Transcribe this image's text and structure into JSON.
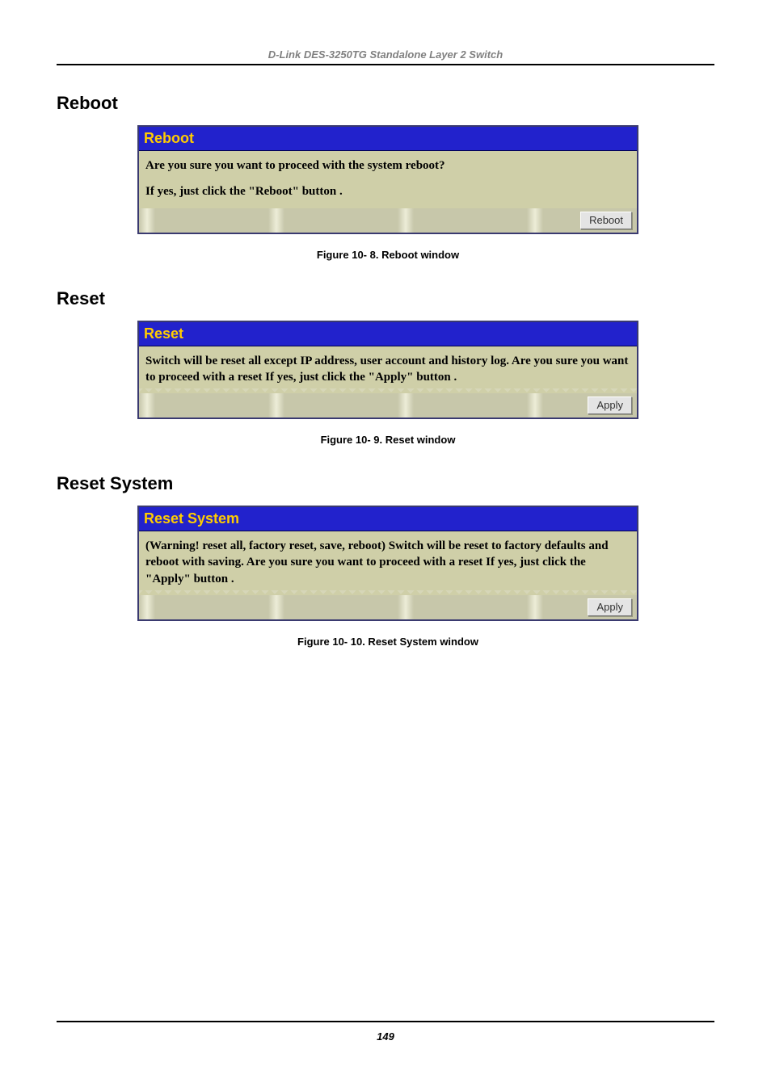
{
  "doc_header": "D-Link DES-3250TG Standalone Layer 2 Switch",
  "sections": {
    "reboot": {
      "heading": "Reboot",
      "panel_title": "Reboot",
      "body_p1": "Are you sure you want to proceed with the system reboot?",
      "body_p2": "If yes, just click the \"Reboot\" button .",
      "button_label": "Reboot",
      "caption": "Figure 10- 8.  Reboot window"
    },
    "reset": {
      "heading": "Reset",
      "panel_title": "Reset",
      "body_p1": "Switch will be reset all except IP address, user account and history log. Are you sure you want to proceed with a reset If yes, just click the \"Apply\" button .",
      "button_label": "Apply",
      "caption": "Figure 10- 9.  Reset window"
    },
    "reset_system": {
      "heading": "Reset System",
      "panel_title": "Reset System",
      "body_p1": "(Warning! reset all, factory reset, save, reboot) Switch will be reset to factory defaults and reboot with saving. Are you sure you want to proceed with a reset If yes, just click the \"Apply\" button .",
      "button_label": "Apply",
      "caption": "Figure 10- 10.  Reset System window"
    }
  },
  "page_number": "149"
}
